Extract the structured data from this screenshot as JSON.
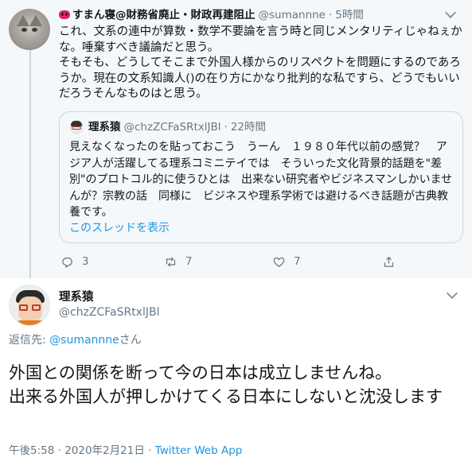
{
  "parent_tweet": {
    "display_name": "すまん寝@財務省廃止・財政再建阻止",
    "handle": "@sumannne",
    "time": "5時間",
    "body": "これ、文系の連中が算数・数学不要論を言う時と同じメンタリティじゃねぇかな。唾棄すべき議論だと思う。\nそもそも、どうしてそこまで外国人様からのリスペクトを問題にするのであろうか。現在の文系知識人()の在り方にかなり批判的な私ですら、どうでもいいだろうそんなものはと思う。",
    "quote": {
      "display_name": "理系猿",
      "handle": "@chzZCFaSRtxlJBl",
      "time": "22時間",
      "body": "見えなくなったのを貼っておこう　うーん　１９８０年代以前の感覚？　アジア人が活躍してる理系コミニテイでは　そういった文化背景的話題を\"差別\"のプロトコル的に使うひとは　出来ない研究者やビジネスマンしかいませんが？宗教の話　同様に　ビジネスや理系学術では避けるべき話題が古典教養です。",
      "show_thread": "このスレッドを表示"
    },
    "actions": {
      "reply_count": "3",
      "retweet_count": "7",
      "like_count": "7",
      "icons": [
        "reply-icon",
        "retweet-icon",
        "like-icon",
        "share-icon"
      ]
    }
  },
  "main_tweet": {
    "display_name": "理系猿",
    "handle": "@chzZCFaSRtxlJBl",
    "reply_prefix": "返信先: ",
    "reply_mention": "@sumannne",
    "reply_suffix": "さん",
    "text": "外国との関係を断って今の日本は成立しませんね。\n出来る外国人が押しかけてくる日本にしないと沈没します",
    "time": "午後5:58",
    "date": "2020年2月21日",
    "app": "Twitter Web App"
  },
  "colors": {
    "link": "#1b95e0",
    "secondary_text": "#657786",
    "thread_background": "#f5f8fa"
  }
}
